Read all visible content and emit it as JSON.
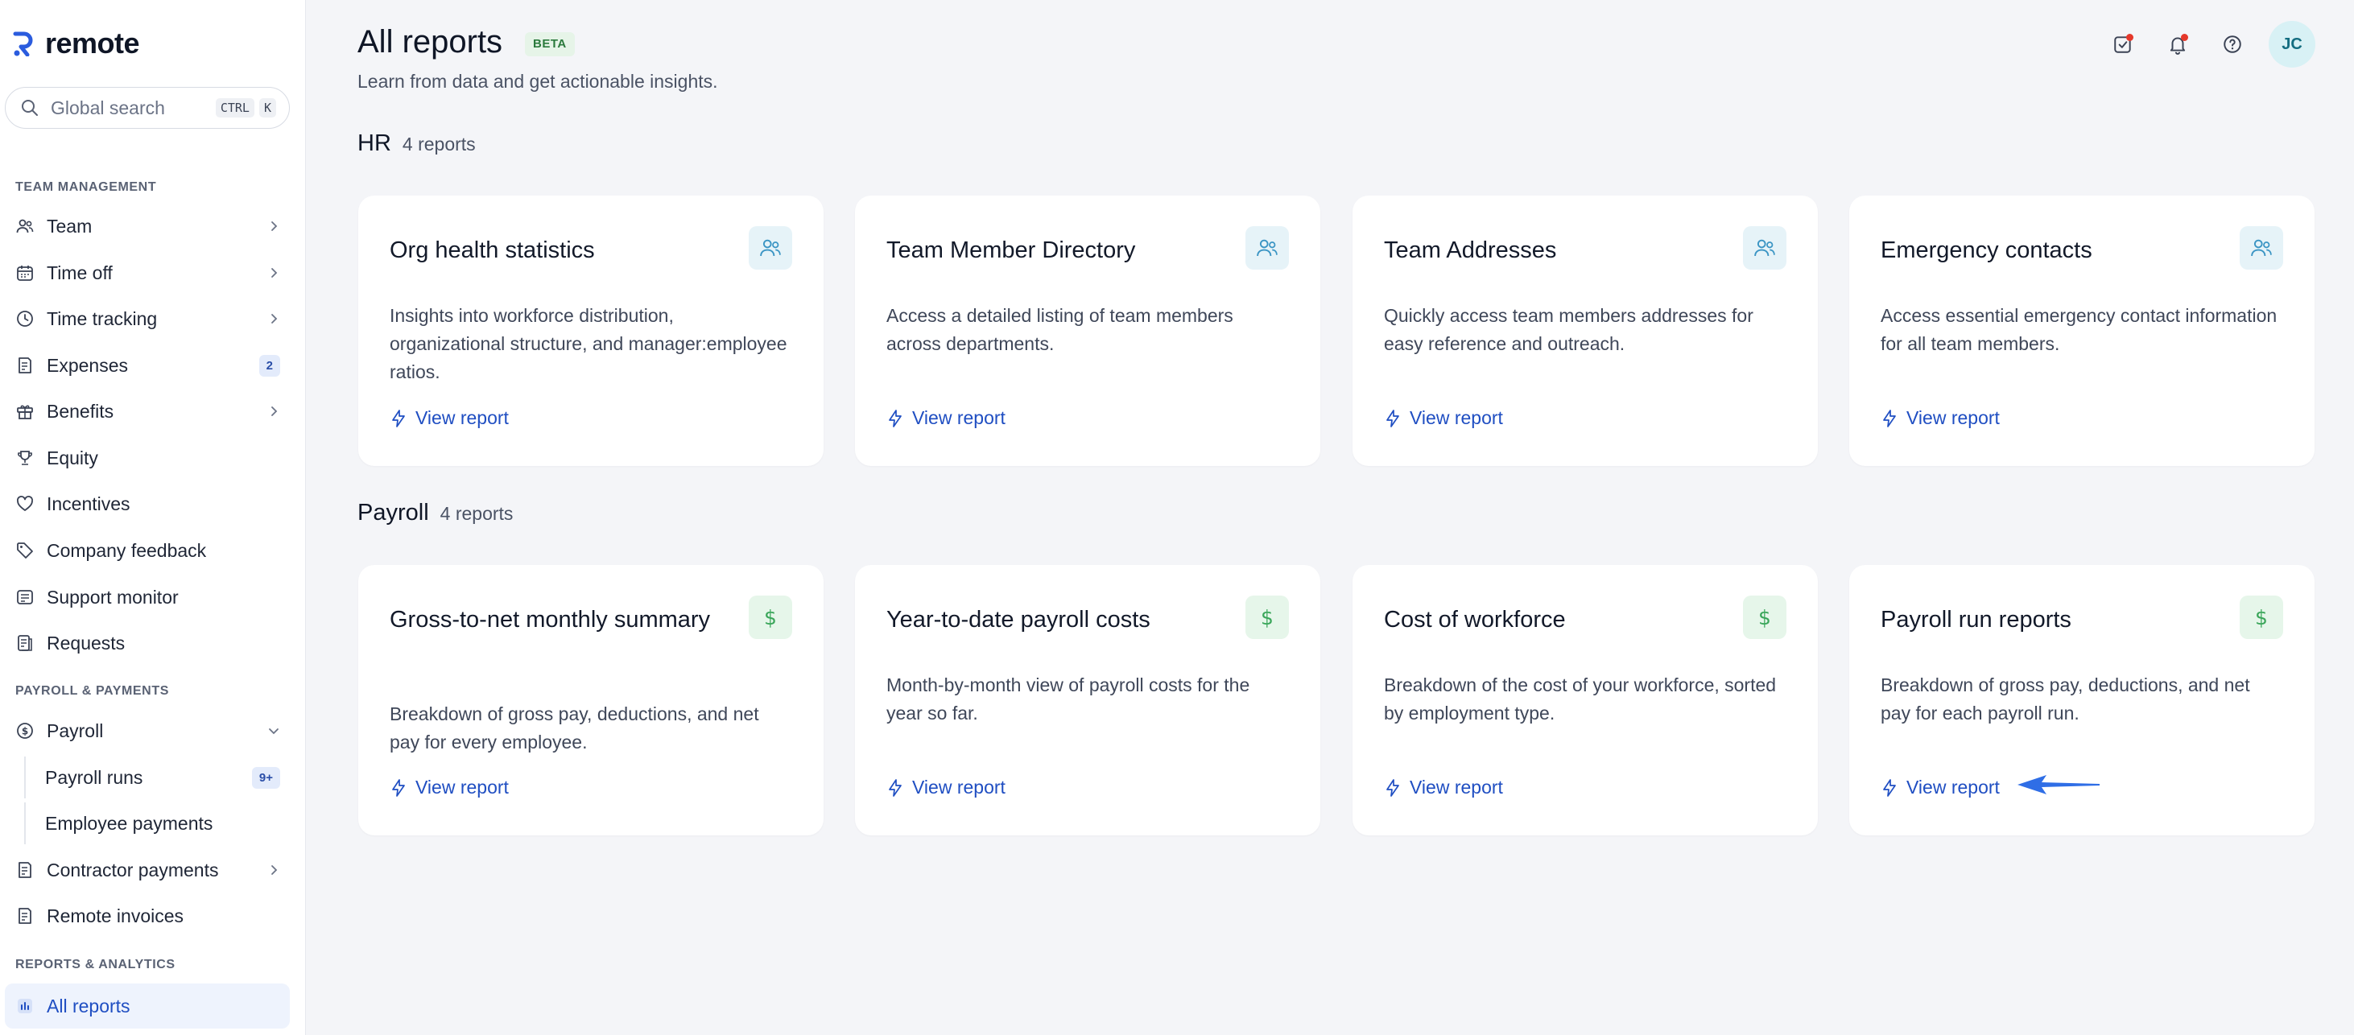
{
  "brand": {
    "name": "remote"
  },
  "search": {
    "placeholder": "Global search",
    "kbd1": "CTRL",
    "kbd2": "K"
  },
  "sidebar": {
    "sections": {
      "team_management": "TEAM MANAGEMENT",
      "payroll_payments": "PAYROLL & PAYMENTS",
      "reports_analytics": "REPORTS & ANALYTICS"
    },
    "items": {
      "team": "Team",
      "time_off": "Time off",
      "time_tracking": "Time tracking",
      "expenses": "Expenses",
      "expenses_badge": "2",
      "benefits": "Benefits",
      "equity": "Equity",
      "incentives": "Incentives",
      "company_feedback": "Company feedback",
      "support_monitor": "Support monitor",
      "requests": "Requests",
      "payroll": "Payroll",
      "payroll_runs": "Payroll runs",
      "payroll_runs_badge": "9+",
      "employee_payments": "Employee payments",
      "contractor_payments": "Contractor payments",
      "remote_invoices": "Remote invoices",
      "all_reports": "All reports"
    }
  },
  "header": {
    "title": "All reports",
    "badge": "BETA",
    "subtitle": "Learn from data and get actionable insights.",
    "avatar_initials": "JC"
  },
  "groups": {
    "hr": {
      "name": "HR",
      "count": "4 reports",
      "cards": [
        {
          "title": "Org health statistics",
          "desc": "Insights into workforce distribution, organizational structure, and manager:employee ratios.",
          "link": "View report"
        },
        {
          "title": "Team Member Directory",
          "desc": "Access a detailed listing of team members across departments.",
          "link": "View report"
        },
        {
          "title": "Team Addresses",
          "desc": "Quickly access team members addresses for easy reference and outreach.",
          "link": "View report"
        },
        {
          "title": "Emergency contacts",
          "desc": "Access essential emergency contact information for all team members.",
          "link": "View report"
        }
      ]
    },
    "payroll": {
      "name": "Payroll",
      "count": "4 reports",
      "cards": [
        {
          "title": "Gross-to-net monthly summary",
          "desc": "Breakdown of gross pay, deductions, and net pay for every employee.",
          "link": "View report"
        },
        {
          "title": "Year-to-date payroll costs",
          "desc": "Month-by-month view of payroll costs for the year so far.",
          "link": "View report"
        },
        {
          "title": "Cost of workforce",
          "desc": "Breakdown of the cost of your workforce, sorted by employment type.",
          "link": "View report"
        },
        {
          "title": "Payroll run reports",
          "desc": "Breakdown of gross pay, deductions, and net pay for each payroll run.",
          "link": "View report"
        }
      ]
    }
  },
  "colors": {
    "accent": "#1f4ec2",
    "brand": "#2b5cde",
    "annotation_arrow": "#2f6ee6"
  }
}
